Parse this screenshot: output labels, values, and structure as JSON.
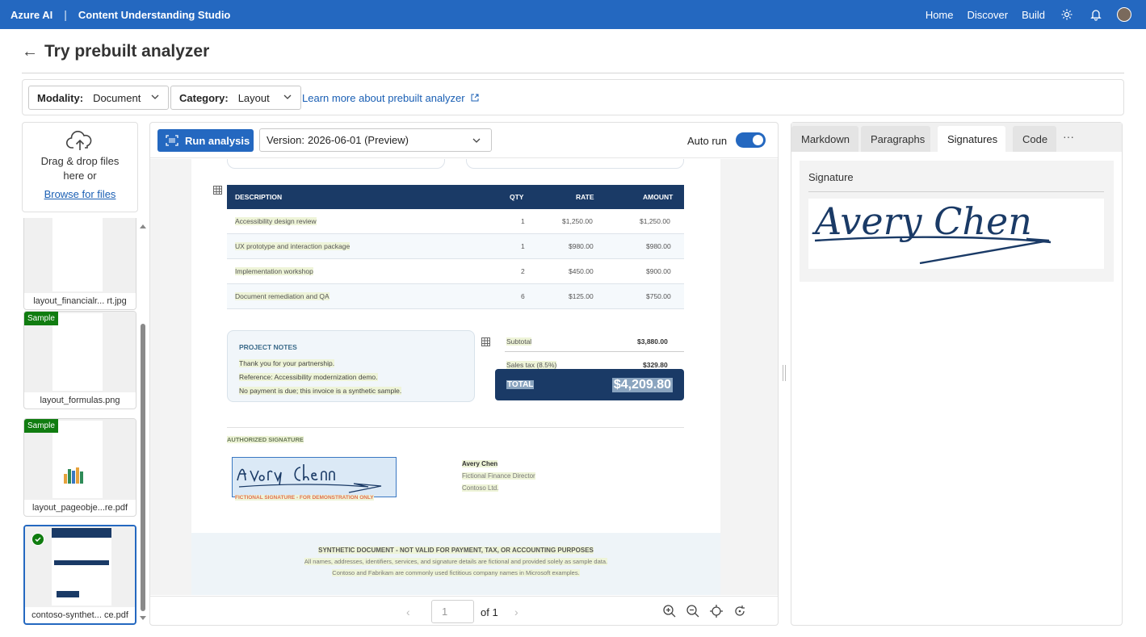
{
  "topbar": {
    "brand": "Azure AI",
    "separator": "|",
    "product": "Content Understanding Studio",
    "nav": [
      "Home",
      "Discover",
      "Build"
    ]
  },
  "page": {
    "title": "Try prebuilt analyzer"
  },
  "filters": {
    "modality_label": "Modality:",
    "modality_value": "Document",
    "category_label": "Category:",
    "category_value": "Layout",
    "learn_more": "Learn more about prebuilt analyzer"
  },
  "upload": {
    "line1": "Drag & drop files",
    "line2": "here or",
    "browse": "Browse for files"
  },
  "files": [
    {
      "name": "layout_financialr... rt.jpg",
      "badge": ""
    },
    {
      "name": "layout_formulas.png",
      "badge": "Sample"
    },
    {
      "name": "layout_pageobje...re.pdf",
      "badge": "Sample"
    },
    {
      "name": "contoso-synthet... ce.pdf",
      "badge": ""
    }
  ],
  "viewer": {
    "run_label": "Run analysis",
    "version_label": "Version:",
    "version_value": "2026-06-01 (Preview)",
    "auto_run": "Auto run",
    "auto_run_on": true,
    "page_input": "1",
    "page_of": "of 1"
  },
  "invoice": {
    "headers": [
      "DESCRIPTION",
      "QTY",
      "RATE",
      "AMOUNT"
    ],
    "rows": [
      [
        "Accessibility design review",
        "1",
        "$1,250.00",
        "$1,250.00"
      ],
      [
        "UX prototype and interaction package",
        "1",
        "$980.00",
        "$980.00"
      ],
      [
        "Implementation workshop",
        "2",
        "$450.00",
        "$900.00"
      ],
      [
        "Document remediation and QA",
        "6",
        "$125.00",
        "$750.00"
      ]
    ],
    "notes_title": "PROJECT NOTES",
    "notes": [
      "Thank you for your partnership.",
      "Reference: Accessibility modernization demo.",
      "No payment is due; this invoice is a synthetic sample."
    ],
    "subtotal_label": "Subtotal",
    "subtotal_value": "$3,880.00",
    "tax_label": "Sales tax (8.5%)",
    "tax_value": "$329.80",
    "total_label": "TOTAL",
    "total_value": "$4,209.80",
    "sig_heading": "AUTHORIZED SIGNATURE",
    "sig_caption": "FICTIONAL SIGNATURE - FOR DEMONSTRATION ONLY",
    "signer_name": "Avery Chen",
    "signer_title": "Fictional Finance Director",
    "signer_org": "Contoso Ltd.",
    "footer_title": "SYNTHETIC DOCUMENT - NOT VALID FOR PAYMENT, TAX, OR ACCOUNTING PURPOSES",
    "footer_line1": "All names, addresses, identifiers, services, and signature details are fictional and provided solely as sample data.",
    "footer_line2": "Contoso and Fabrikam are commonly used fictitious company names in Microsoft examples."
  },
  "results": {
    "tabs": [
      "Markdown",
      "Paragraphs",
      "Signatures",
      "Code"
    ],
    "active_tab": "Signatures",
    "more": "···",
    "section_label": "Signature",
    "signature_text": "Avery Chen"
  },
  "colors": {
    "brand": "#2468c0",
    "invoice_navy": "#1a3a66",
    "sample_badge": "#107c10"
  }
}
